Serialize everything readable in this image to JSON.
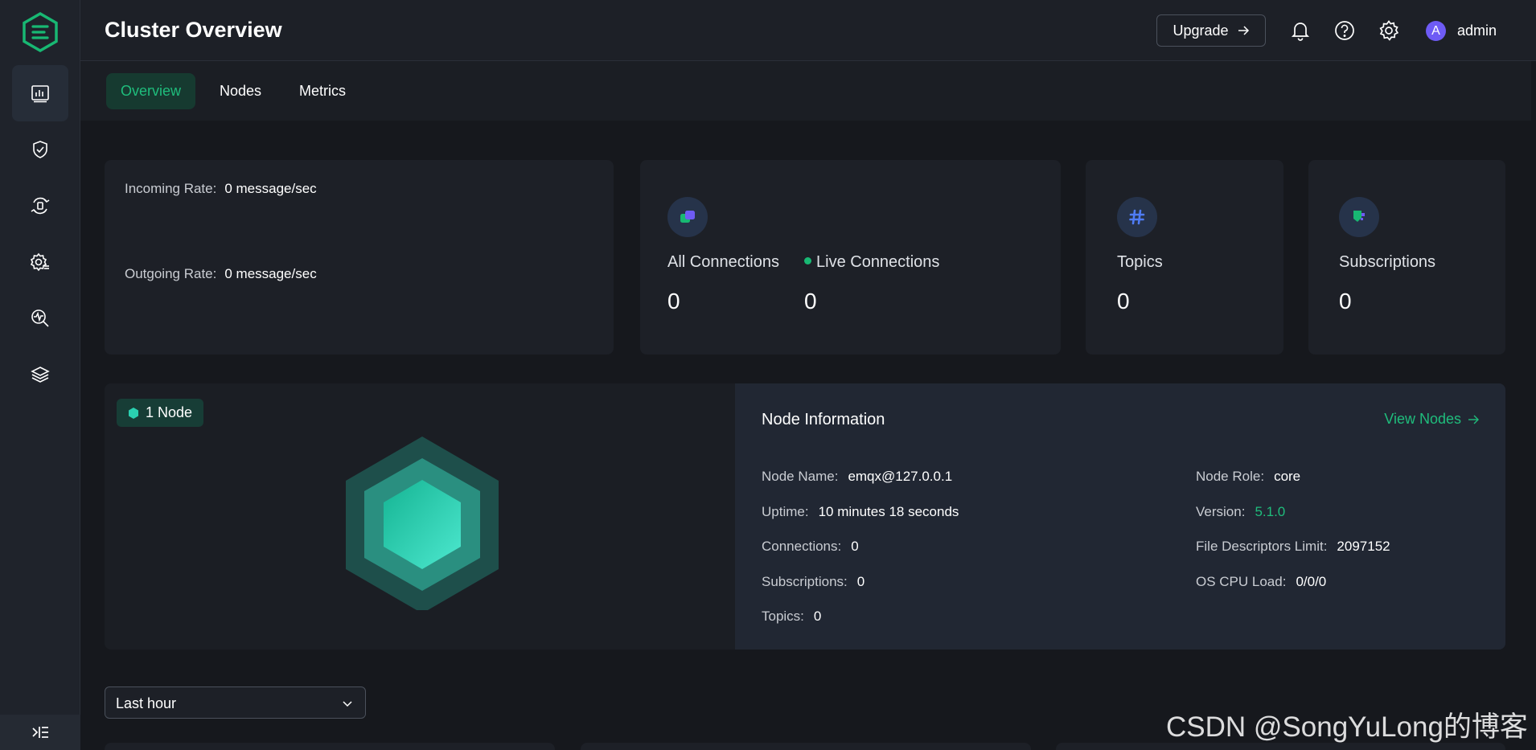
{
  "header": {
    "title": "Cluster Overview",
    "upgrade_label": "Upgrade",
    "avatar_initial": "A",
    "username": "admin"
  },
  "sidebar": {
    "items": [
      {
        "icon": "dashboard-icon",
        "active": true
      },
      {
        "icon": "shield-icon",
        "active": false
      },
      {
        "icon": "data-integration-icon",
        "active": false
      },
      {
        "icon": "management-gear-icon",
        "active": false
      },
      {
        "icon": "diagnose-icon",
        "active": false
      },
      {
        "icon": "extensions-layers-icon",
        "active": false
      }
    ]
  },
  "tabs": [
    {
      "label": "Overview",
      "active": true
    },
    {
      "label": "Nodes",
      "active": false
    },
    {
      "label": "Metrics",
      "active": false
    }
  ],
  "rates": {
    "incoming_label": "Incoming Rate:",
    "incoming_value": "0 message/sec",
    "outgoing_label": "Outgoing Rate:",
    "outgoing_value": "0 message/sec"
  },
  "stats": {
    "all_connections_label": "All Connections",
    "all_connections_value": "0",
    "live_connections_label": "Live Connections",
    "live_connections_value": "0",
    "topics_label": "Topics",
    "topics_value": "0",
    "subscriptions_label": "Subscriptions",
    "subscriptions_value": "0"
  },
  "nodes": {
    "badge": "1 Node",
    "info_title": "Node Information",
    "view_nodes_label": "View Nodes",
    "left_fields": [
      {
        "label": "Node Name:",
        "value": "emqx@127.0.0.1"
      },
      {
        "label": "Uptime:",
        "value": "10 minutes 18 seconds"
      },
      {
        "label": "Connections:",
        "value": "0"
      },
      {
        "label": "Subscriptions:",
        "value": "0"
      },
      {
        "label": "Topics:",
        "value": "0"
      }
    ],
    "right_fields": [
      {
        "label": "Node Role:",
        "value": "core"
      },
      {
        "label": "Version:",
        "value": "5.1.0"
      },
      {
        "label": "File Descriptors Limit:",
        "value": "2097152"
      },
      {
        "label": "OS CPU Load:",
        "value": "0/0/0"
      }
    ]
  },
  "time_range": {
    "selected": "Last hour"
  },
  "watermark": "CSDN @SongYuLong的博客",
  "colors": {
    "accent": "#1fbd7c",
    "background": "#16181d",
    "card": "#1d2027",
    "avatar": "#6e5bf5"
  }
}
